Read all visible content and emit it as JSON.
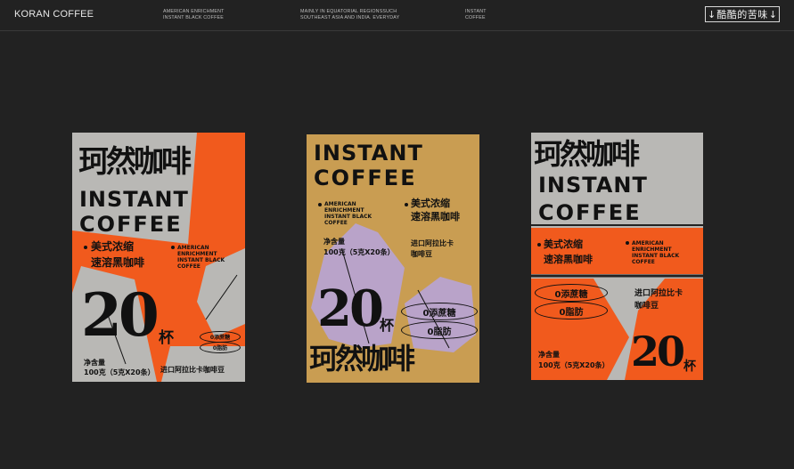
{
  "header": {
    "brand": "KORAN COFFEE",
    "nav": [
      "AMERICAN ENRICHMENT\nINSTANT BLACK COFFEE",
      "MAINLY IN EQUATORIAL REGIONSSUCH\nSOUTHEAST ASIA AND INDIA. EVERYDAY",
      "INSTANT\nCOFFEE"
    ],
    "title_arrow_left": "↓",
    "title": "酷酷的苦味",
    "title_arrow_right": "↓"
  },
  "posters": [
    {
      "brand_cn": "珂然咖啡",
      "instant": "INSTANT",
      "coffee": "COFFEE",
      "desc_cn_1": "美式浓缩",
      "desc_cn_2": "速溶黑咖啡",
      "desc_en": "AMERICAN\nENRICHMENT\nINSTANT BLACK\nCOFFEE",
      "count": "20",
      "unit": "杯",
      "sugar": "0添蔗糖",
      "fat": "0脂肪",
      "net_label": "净含量",
      "net_value": "100克（5克X20条）",
      "origin": "进口阿拉比卡咖啡豆"
    },
    {
      "instant": "INSTANT",
      "coffee": "COFFEE",
      "desc_en": "AMERICAN\nENRICHMENT\nINSTANT BLACK\nCOFFEE",
      "desc_cn_1": "美式浓缩",
      "desc_cn_2": "速溶黑咖啡",
      "net_label": "净含量",
      "net_value": "100克（5克X20条）",
      "origin": "进口阿拉比卡\n咖啡豆",
      "count": "20",
      "unit": "杯",
      "sugar": "0添蔗糖",
      "fat": "0脂肪",
      "brand_cn": "珂然咖啡"
    },
    {
      "brand_cn": "珂然咖啡",
      "instant": "INSTANT",
      "coffee": "COFFEE",
      "desc_cn_1": "美式浓缩",
      "desc_cn_2": "速溶黑咖啡",
      "desc_en": "AMERICAN\nENRICHMENT\nINSTANT BLACK\nCOFFEE",
      "sugar": "0添蔗糖",
      "fat": "0脂肪",
      "origin": "进口阿拉比卡\n咖啡豆",
      "net_label": "净含量",
      "net_value": "100克（5克X20条）",
      "count": "20",
      "unit": "杯"
    }
  ],
  "colors": {
    "background": "#222222",
    "orange": "#f15a1d",
    "gray": "#b9b8b5",
    "tan": "#c99d52",
    "lavender": "#b9a3c9",
    "ink": "#111111"
  }
}
